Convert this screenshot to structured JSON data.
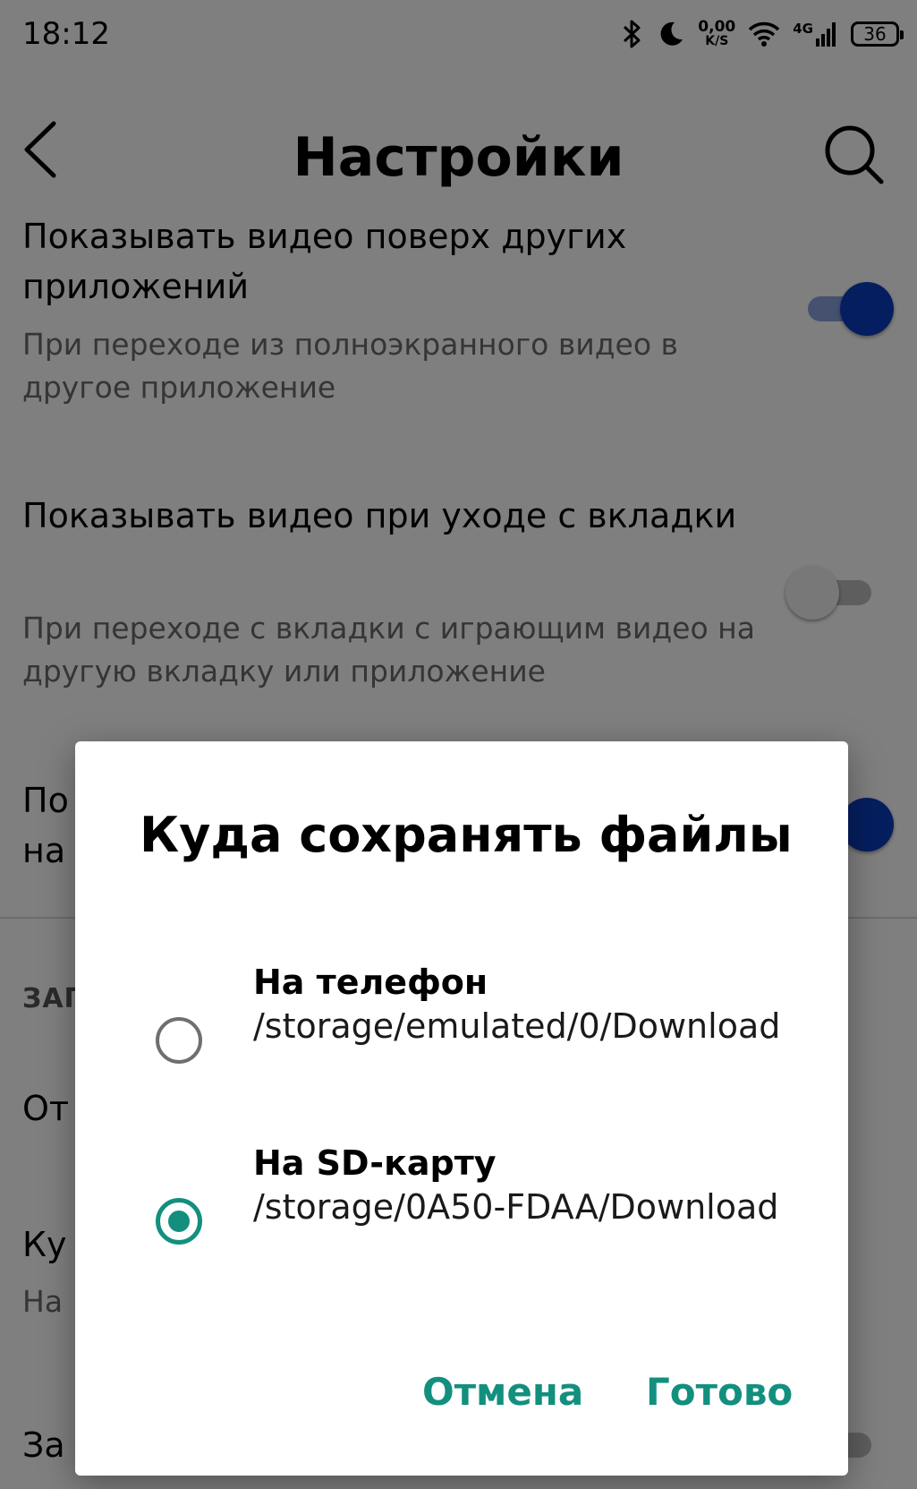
{
  "status_bar": {
    "time": "18:12",
    "net_speed_value": "0,00",
    "net_speed_unit": "K/S",
    "network_type": "4G",
    "battery_level": "36",
    "icons": [
      "bluetooth-icon",
      "moon-icon",
      "wifi-icon",
      "signal-icon",
      "battery-icon"
    ]
  },
  "header": {
    "title": "Настройки",
    "back_icon": "chevron-left-icon",
    "search_icon": "search-icon"
  },
  "settings": {
    "items": [
      {
        "title": "Показывать видео поверх других приложений",
        "description": "При переходе из полноэкранного видео в другое приложение",
        "toggle": "on"
      },
      {
        "title": "Показывать видео при уходе с вкладки",
        "description": "При переходе с вкладки с играющим видео на другую вкладку или приложение",
        "toggle": "off"
      },
      {
        "title": "По",
        "title_line2": "на",
        "toggle": "on"
      }
    ],
    "section_header": "ЗАГ",
    "item_partial_1": "От",
    "item_partial_2": "Ку",
    "item_partial_2_desc": "На",
    "item_partial_3": "За"
  },
  "dialog": {
    "title": "Куда сохранять файлы",
    "options": [
      {
        "label": "На телефон",
        "path": "/storage/emulated/0/Download",
        "checked": false
      },
      {
        "label": "На SD-карту",
        "path": "/storage/0A50-FDAA/Download",
        "checked": true
      }
    ],
    "cancel_label": "Отмена",
    "done_label": "Готово"
  },
  "colors": {
    "accent": "#138f7e",
    "toggle_on": "#0b3dbf",
    "scrim": "rgba(0,0,0,0.5)"
  }
}
